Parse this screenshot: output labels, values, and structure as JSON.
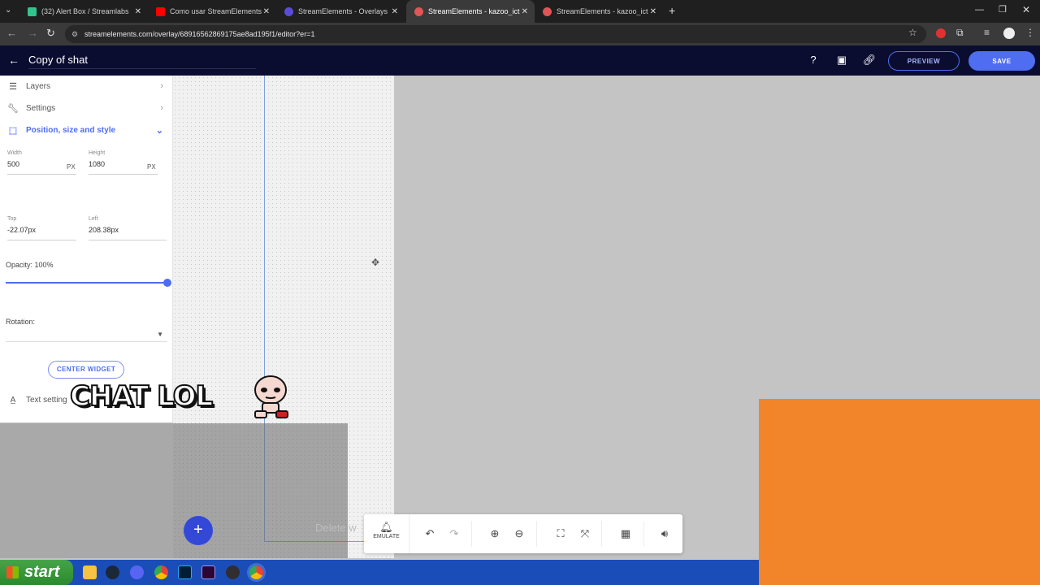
{
  "browser": {
    "tabs": [
      {
        "label": "(32) Alert Box / Streamlabs",
        "color": "#31c48d"
      },
      {
        "label": "Como usar StreamElements en",
        "color": "#ff0000"
      },
      {
        "label": "StreamElements - Overlays",
        "color": "#5b4bd8"
      },
      {
        "label": "StreamElements - kazoo_ict",
        "color": "#e05555"
      },
      {
        "label": "StreamElements - kazoo_ict",
        "color": "#e05555"
      }
    ],
    "url": "streamelements.com/overlay/68916562869175ae8ad195f1/editor?er=1"
  },
  "header": {
    "title": "Copy of shat",
    "preview_label": "PREVIEW",
    "save_label": "SAVE",
    "accent": "#4f6df0",
    "background": "#0a0d30"
  },
  "panel": {
    "layers_label": "Layers",
    "settings_label": "Settings",
    "position_label": "Position, size and style",
    "width_label": "Width",
    "width_value": "500",
    "height_label": "Height",
    "height_value": "1080",
    "unit_px": "PX",
    "top_label": "Top",
    "top_value": "-22.07px",
    "left_label": "Left",
    "left_value": "208.38px",
    "opacity_label": "Opacity: 100%",
    "opacity_value": 1.0,
    "rotation_label": "Rotation:",
    "center_widget_label": "CENTER WIDGET",
    "text_settings_label": "Text setting"
  },
  "canvas": {
    "overlay_text": "CHAT LOL",
    "faded_text": "Delete w",
    "orange": "#f2852a"
  },
  "toolbar": {
    "emulate_label": "EMULATE"
  },
  "taskbar": {
    "start_label": "start"
  }
}
